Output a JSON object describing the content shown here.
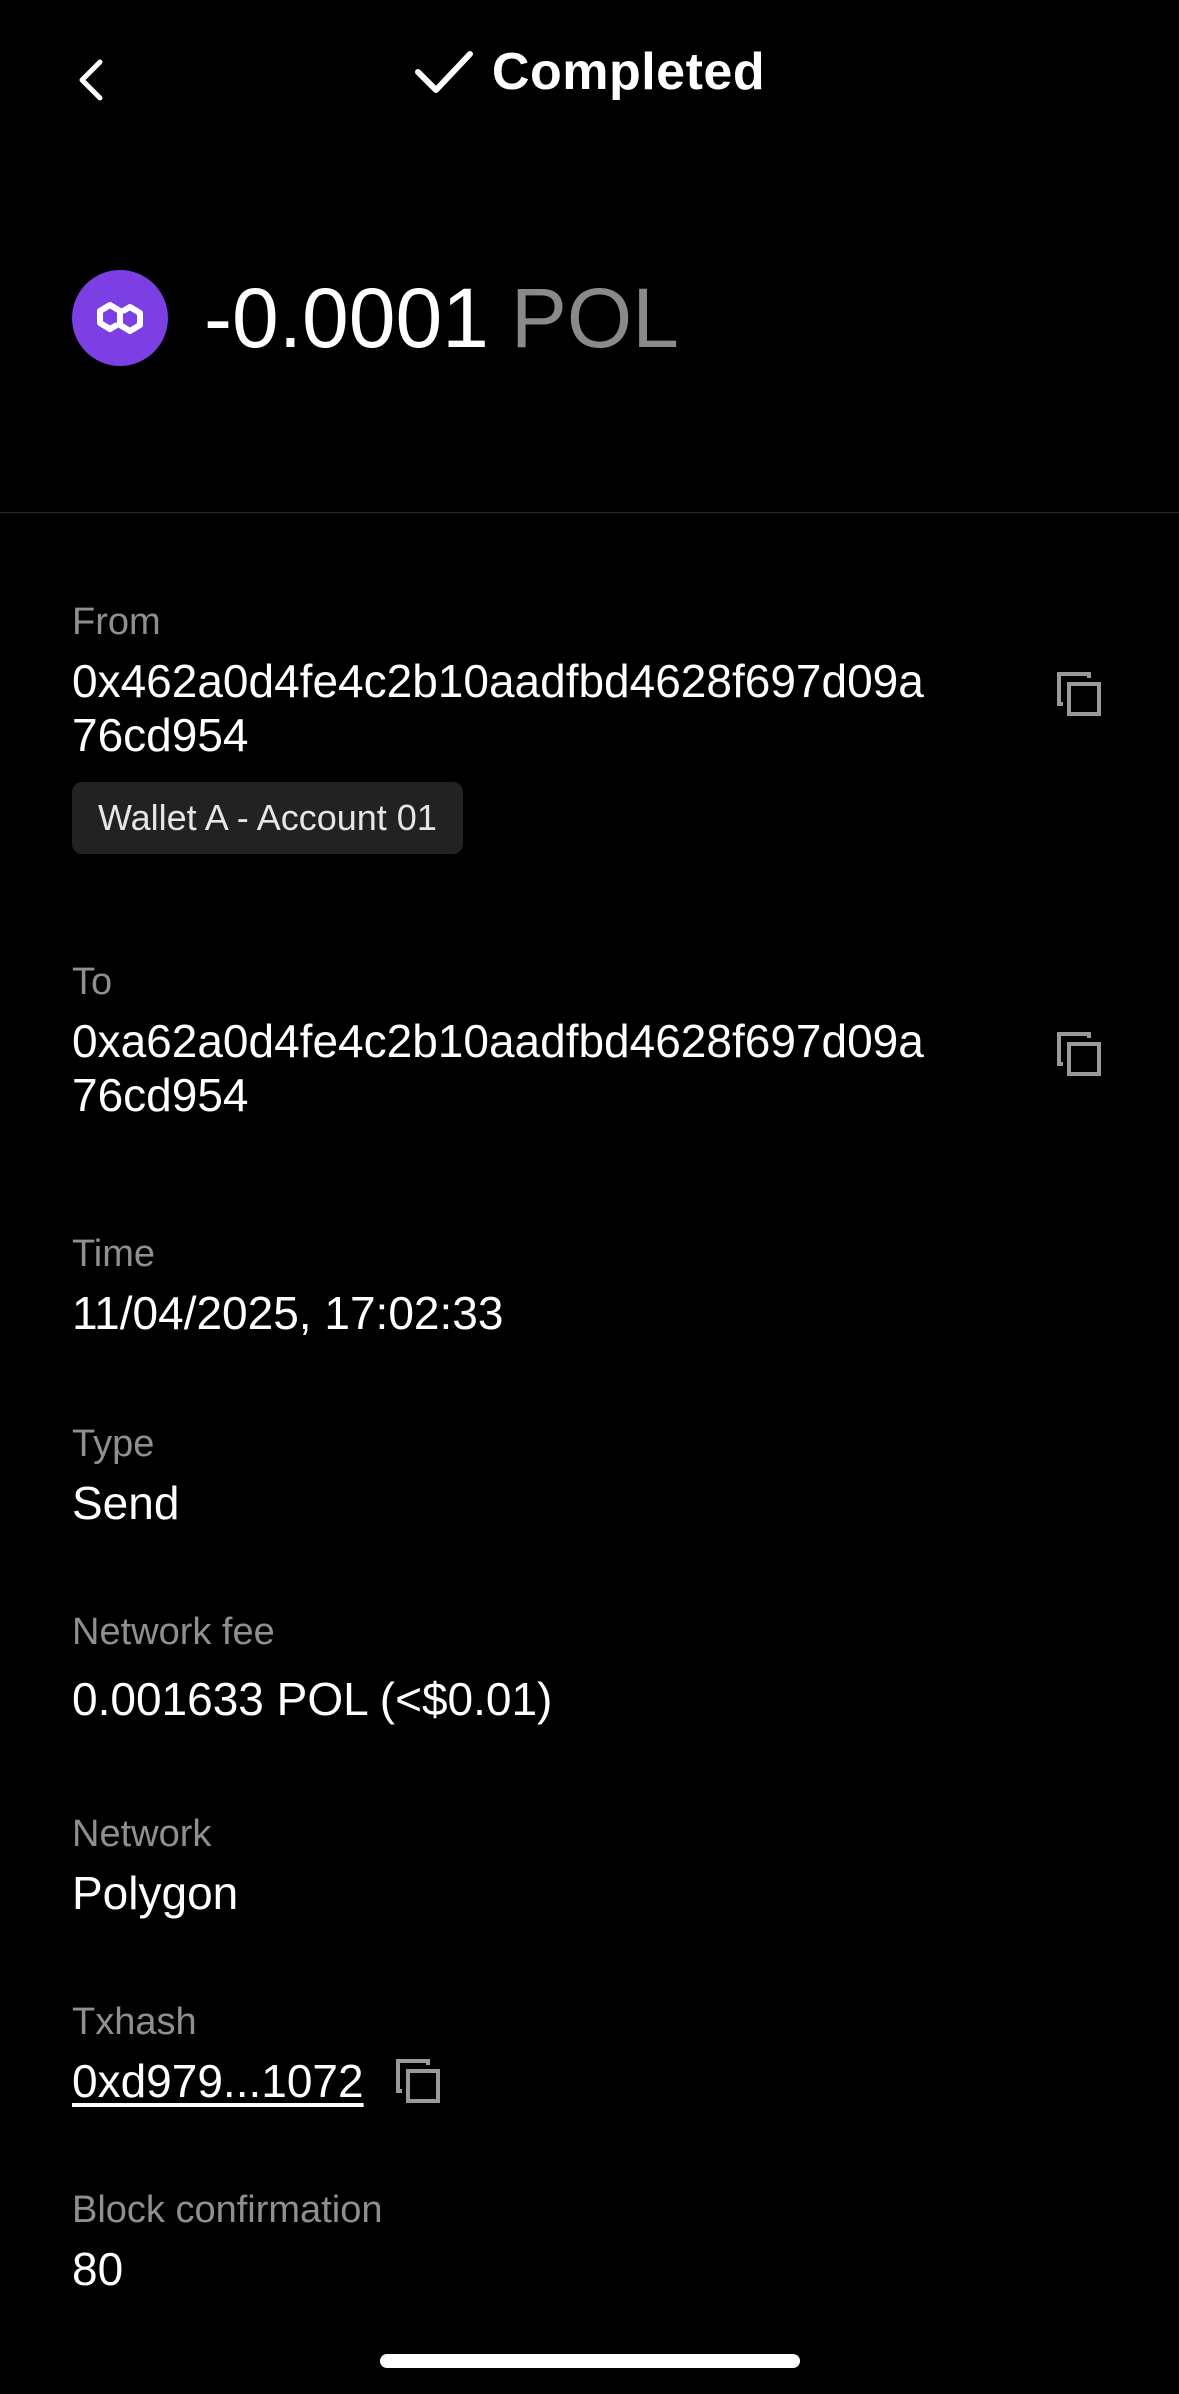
{
  "header": {
    "title": "Completed"
  },
  "transaction": {
    "amount": "-0.0001",
    "symbol": "POL",
    "token_icon": "polygon-logo-icon",
    "token_color": "#7b3fe4"
  },
  "fields": {
    "from": {
      "label": "From",
      "address": "0x462a0d4fe4c2b10aadfbd4628f697d09a76cd954",
      "account_badge": "Wallet A - Account 01"
    },
    "to": {
      "label": "To",
      "address": "0xa62a0d4fe4c2b10aadfbd4628f697d09a76cd954"
    },
    "time": {
      "label": "Time",
      "value": "11/04/2025, 17:02:33"
    },
    "type": {
      "label": "Type",
      "value": "Send"
    },
    "network_fee": {
      "label": "Network fee",
      "value": "0.001633 POL (<$0.01)"
    },
    "network": {
      "label": "Network",
      "value": "Polygon"
    },
    "txhash": {
      "label": "Txhash",
      "value": "0xd979...1072"
    },
    "block_confirmation": {
      "label": "Block confirmation",
      "value": "80"
    }
  },
  "icons": {
    "back": "chevron-left-icon",
    "status": "checkmark-icon",
    "copy": "copy-icon"
  }
}
